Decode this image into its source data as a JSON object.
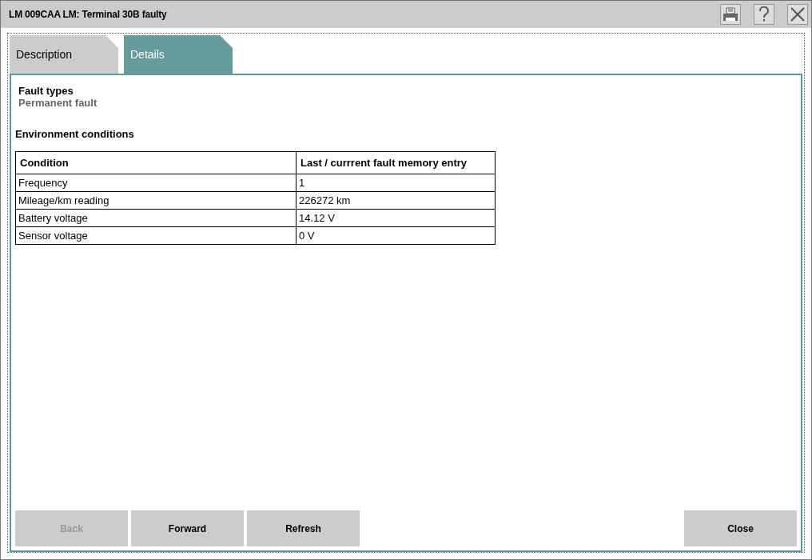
{
  "window": {
    "title": "LM 009CAA LM: Terminal 30B faulty"
  },
  "tabs": [
    {
      "label": "Description",
      "selected": false
    },
    {
      "label": "Details",
      "selected": true
    }
  ],
  "fault_types": {
    "heading": "Fault types",
    "value": "Permanent fault"
  },
  "environment": {
    "heading": "Environment conditions",
    "columns": [
      "Condition",
      "Last / currrent fault memory entry"
    ],
    "rows": [
      [
        "Frequency",
        "1"
      ],
      [
        "Mileage/km reading",
        "226272 km"
      ],
      [
        "Battery voltage",
        "14.12 V"
      ],
      [
        "Sensor voltage",
        "0 V"
      ]
    ]
  },
  "buttons": [
    {
      "label": "Back",
      "disabled": true,
      "kind": "left"
    },
    {
      "label": "Forward",
      "disabled": false,
      "kind": "left"
    },
    {
      "label": "Refresh",
      "disabled": false,
      "kind": "left"
    },
    {
      "label": "Close",
      "disabled": false,
      "kind": "right"
    }
  ]
}
